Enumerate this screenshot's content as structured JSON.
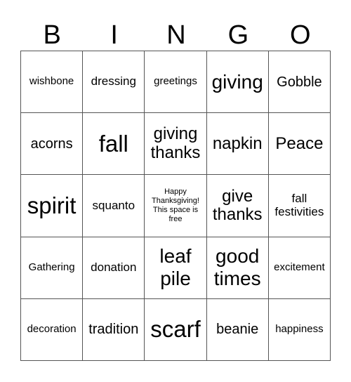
{
  "header": [
    "B",
    "I",
    "N",
    "G",
    "O"
  ],
  "cells": [
    {
      "text": "wishbone",
      "size": "s1"
    },
    {
      "text": "dressing",
      "size": "s2"
    },
    {
      "text": "greetings",
      "size": "s1"
    },
    {
      "text": "giving",
      "size": "s5"
    },
    {
      "text": "Gobble",
      "size": "s3"
    },
    {
      "text": "acorns",
      "size": "s3"
    },
    {
      "text": "fall",
      "size": "s6"
    },
    {
      "text": "giving thanks",
      "size": "s4"
    },
    {
      "text": "napkin",
      "size": "s4"
    },
    {
      "text": "Peace",
      "size": "s4"
    },
    {
      "text": "spirit",
      "size": "s6"
    },
    {
      "text": "squanto",
      "size": "s2"
    },
    {
      "text": "Happy Thanksgiving! This space is free",
      "size": "s0"
    },
    {
      "text": "give thanks",
      "size": "s4"
    },
    {
      "text": "fall festivities",
      "size": "s2"
    },
    {
      "text": "Gathering",
      "size": "s1"
    },
    {
      "text": "donation",
      "size": "s2"
    },
    {
      "text": "leaf pile",
      "size": "s5"
    },
    {
      "text": "good times",
      "size": "s5"
    },
    {
      "text": "excitement",
      "size": "s1"
    },
    {
      "text": "decoration",
      "size": "s1"
    },
    {
      "text": "tradition",
      "size": "s3"
    },
    {
      "text": "scarf",
      "size": "s6"
    },
    {
      "text": "beanie",
      "size": "s3"
    },
    {
      "text": "happiness",
      "size": "s1"
    }
  ]
}
